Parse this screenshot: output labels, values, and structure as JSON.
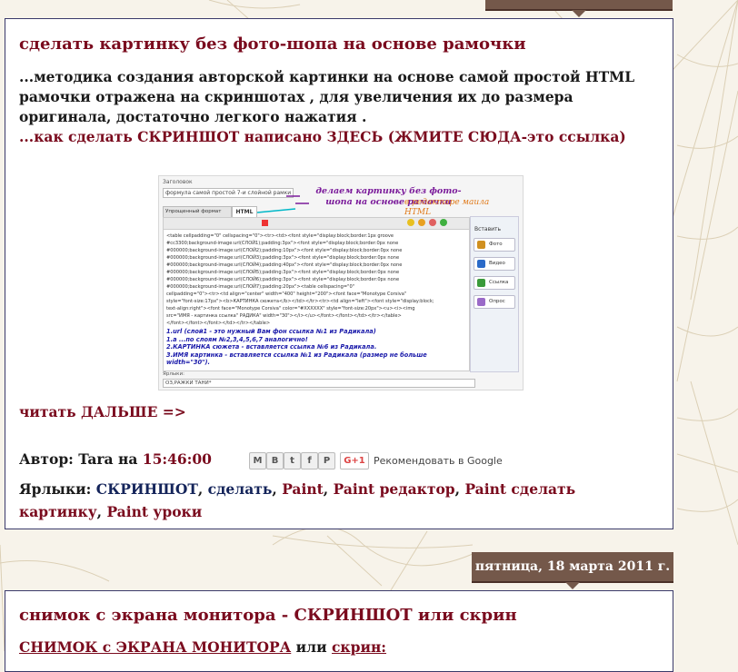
{
  "post1": {
    "title": "сделать картинку без фото-шопа на основе рамочки",
    "paragraph": "...методика создания авторской картинки на основе самой простой HTML рамочки отражена на скриншотах , для увеличения их до размера оригинала, достаточно легкого нажатия .",
    "link_prefix": "...",
    "link_text": "как сделать СКРИНШОТ написано ЗДЕСЬ (ЖМИТЕ СЮДА-это ссылка)",
    "read_more": "читать ДАЛЬШЕ =>",
    "author_label": "Автор: ",
    "author_name": "Tara",
    "author_at": " на ",
    "time": "15:46:00",
    "share_icons": [
      "M",
      "B",
      "t",
      "f",
      "P"
    ],
    "gplus": "G+1",
    "recommend": "Рекомендовать в Google",
    "labels_label": "Ярлыки: ",
    "labels": [
      {
        "text": "СКРИНШОТ",
        "color": "#14245a"
      },
      {
        "text": "сделать",
        "color": "#14245a"
      },
      {
        "text": "Paint",
        "color": "#7a0b1e"
      },
      {
        "text": "Paint редактор",
        "color": "#7a0b1e"
      },
      {
        "text": "Paint сделать картинку",
        "color": "#7a0b1e"
      },
      {
        "text": "Paint уроки",
        "color": "#7a0b1e"
      }
    ]
  },
  "screenshot": {
    "heading_label": "Заголовок",
    "heading_value": "формула самой простой 7-и слойной рамки",
    "annotation1": "делаем картинку без фото-шопа на основе рамочки",
    "annotation2": "в редакторе маила HTML",
    "tab_compose": "Упрощенный формат",
    "tab_html": "HTML",
    "insert_label": "Вставить",
    "side_buttons": [
      "Фото",
      "Видео",
      "Ссылка",
      "Опрос"
    ],
    "code_lines": [
      "<table cellpadding=\"0\" cellspacing=\"0\"><tr><td><font style=\"display:block;border:1px groove",
      "#cc3300;background-image:url(СЛОЙ1);padding:3px\"><font style=\"display:block;border:0px none",
      "#000000;background-image:url(СЛОЙ2);padding:10px\"><font style=\"display:block;border:0px none",
      "#000000;background-image:url(СЛОЙ3);padding:3px\"><font style=\"display:block;border:0px none",
      "#000000;background-image:url(СЛОЙ4);padding:40px\"><font style=\"display:block;border:0px none",
      "#000000;background-image:url(СЛОЙ5);padding:3px\"><font style=\"display:block;border:0px none",
      "#000000;background-image:url(СЛОЙ6);padding:3px\"><font style=\"display:block;border:0px none",
      "#000000;background-image:url(СЛОЙ7);padding:20px\"><table cellspacing=\"0\"",
      "cellpadding=\"0\"><tr><td align=\"center\" width=\"400\" height=\"200\"><font face=\"Monotype Corsiva\"",
      "style=\"font-size:17px\"><b>КАРТИНКА сюжета</b></td></tr><tr><td align=\"left\"><font style=\"display:block;",
      "text-align:right\"><font face=\"Monotype Corsiva\" color=\"#XXXXXX\" style=\"font-size:20px\"><u><i><img",
      "src=\"ИМЯ - картинка ссылка\" РАДИКА\" width=\"30\"></i></u></font></font></td></tr></table>",
      "</font></font></font></td></tr></table>"
    ],
    "notes": [
      "1.url (слой1 - это нужный Вам фон ссылка №1 из Радикала)",
      "1.а ...по слоям №2,3,4,5,6,7 аналогично!",
      "2.КАРТИНКА сюжета - вставляется ссылка №6 из Радикала.",
      "3.ИМЯ картинка - вставляется ссылка №1 из Радикала (размер не больше",
      "width=\"30\")."
    ],
    "labels_field_label": "Ярлыки:",
    "labels_field_value": "ОЗ,РАЖКИ ТАНИ*"
  },
  "date2": "пятница, 18 марта 2011 г.",
  "post2": {
    "title": "снимок с экрана монитора - СКРИНШОТ или скрин",
    "line_a": "СНИМОК с ЭКРАНА МОНИТОРА",
    "line_b": " или ",
    "line_c": "скрин:"
  },
  "colors": {
    "link_red": "#7a0b1e",
    "link_navy": "#14245a",
    "date_tab": "#74584a"
  }
}
